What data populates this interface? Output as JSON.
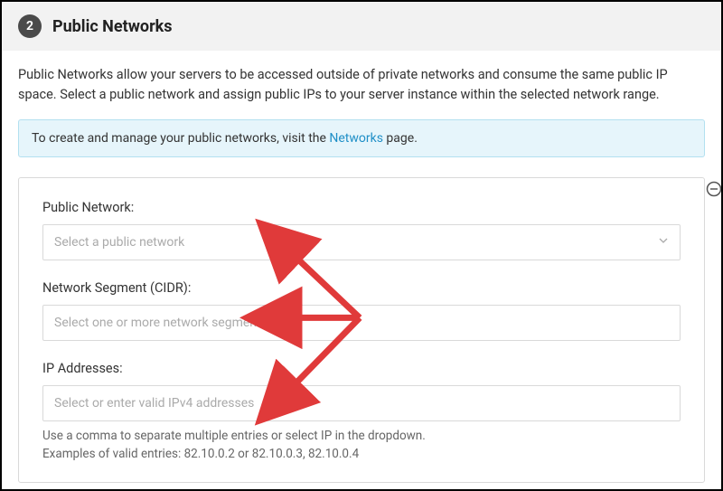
{
  "header": {
    "step_number": "2",
    "title": "Public Networks"
  },
  "description": "Public Networks allow your servers to be accessed outside of private networks and consume the same public IP space. Select a public network and assign public IPs to your server instance within the selected network range.",
  "banner": {
    "prefix": "To create and manage your public networks, visit the ",
    "link_text": "Networks",
    "suffix": " page."
  },
  "form": {
    "public_network": {
      "label": "Public Network:",
      "placeholder": "Select a public network"
    },
    "network_segment": {
      "label": "Network Segment (CIDR):",
      "placeholder": "Select one or more network segments"
    },
    "ip_addresses": {
      "label": "IP Addresses:",
      "placeholder": "Select or enter valid IPv4 addresses",
      "helper_line1": "Use a comma to separate multiple entries or select IP in the dropdown.",
      "helper_line2": "Examples of valid entries: 82.10.0.2 or 82.10.0.3, 82.10.0.4"
    }
  },
  "colors": {
    "arrow": "#e03a3a",
    "banner_bg": "#e6f5fb",
    "banner_border": "#b3e0f0",
    "link": "#1f8fc7"
  }
}
